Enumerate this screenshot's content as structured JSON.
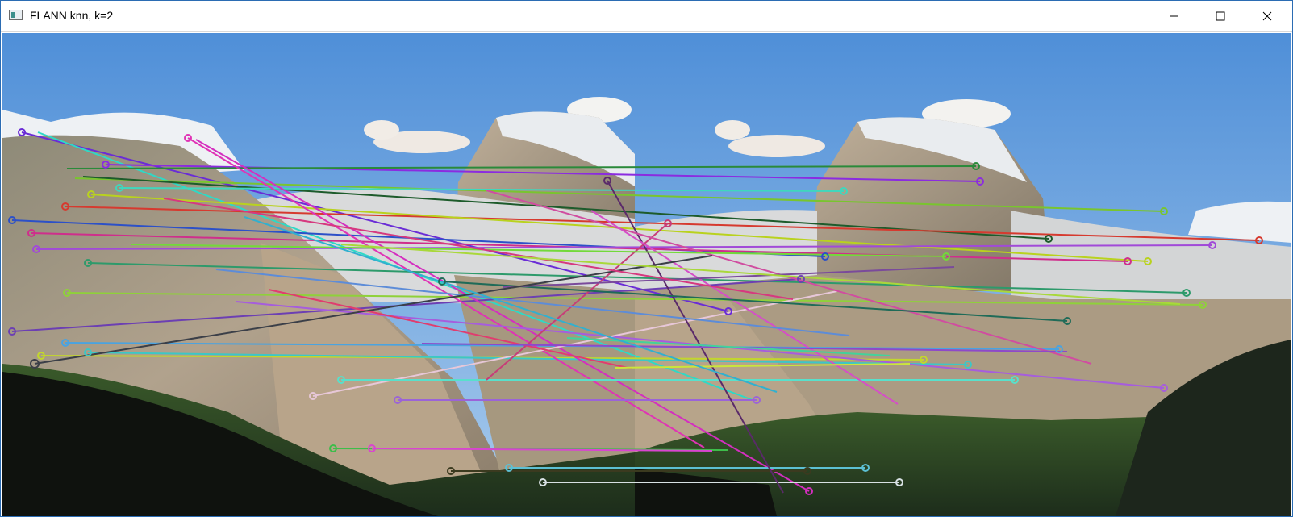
{
  "window": {
    "title": "FLANN knn, k=2",
    "icons": {
      "app": "opencv-window-icon",
      "minimize": "minimize-icon",
      "maximize": "maximize-icon",
      "close": "close-icon"
    }
  },
  "colors": {
    "window_border": "#2b6cb3",
    "sky_top": "#4f8fd8",
    "sky_bottom": "#a9cbec",
    "rock": "#a89a86",
    "forest": "#233a22",
    "snow": "#eef1f4"
  }
}
